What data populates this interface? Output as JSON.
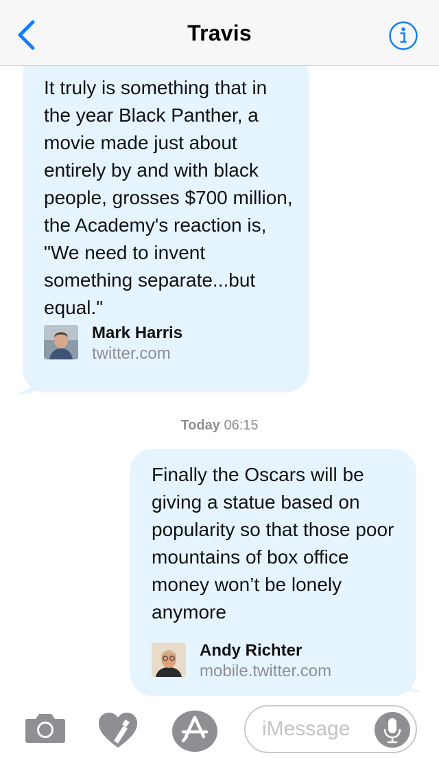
{
  "header": {
    "title": "Travis"
  },
  "messages": [
    {
      "direction": "incoming",
      "text": "It truly is something that in the year Black Panther, a movie made just about entirely by and with black people, grosses $700 million, the Academy's reaction is, \"We need to invent something separate...but equal.\"",
      "link": {
        "name": "Mark Harris",
        "domain": "twitter.com"
      }
    },
    {
      "direction": "outgoing",
      "text": "Finally the Oscars will be giving a statue based on popularity so that those poor mountains of box office money won’t be lonely anymore",
      "link": {
        "name": "Andy Richter",
        "domain": "mobile.twitter.com"
      }
    }
  ],
  "timestamp": {
    "day": "Today",
    "time": "06:15"
  },
  "input": {
    "placeholder": "iMessage"
  },
  "icons": {
    "back": "chevron-left-icon",
    "info": "info-icon",
    "camera": "camera-icon",
    "digital_touch": "digital-touch-heart-icon",
    "app_store": "app-store-icon",
    "microphone": "microphone-icon"
  },
  "colors": {
    "accent": "#147efb",
    "bubble": "#e6f4ff",
    "secondary_text": "#8e8e93",
    "toolbar_icon": "#8e8e93"
  }
}
